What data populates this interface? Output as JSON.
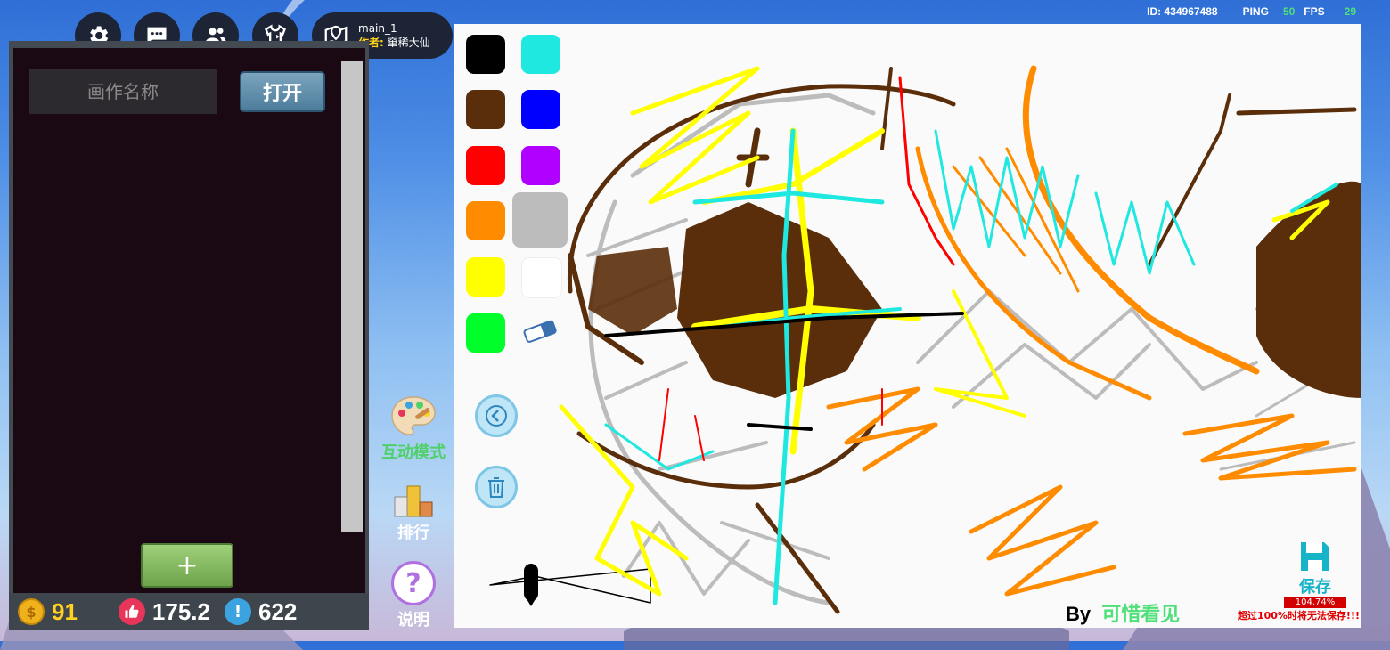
{
  "top_bar": {
    "buttons": [
      {
        "name": "settings",
        "icon": "gear-icon"
      },
      {
        "name": "chat",
        "icon": "chat-icon"
      },
      {
        "name": "friends",
        "icon": "friends-icon"
      },
      {
        "name": "outfit",
        "icon": "shirt-icon"
      }
    ],
    "map": {
      "icon": "map-pin-icon",
      "name": "main_1",
      "author_label": "作者:",
      "author": "窜稀大仙"
    }
  },
  "stats": {
    "id_label": "ID:",
    "id": "434967488",
    "ping_label": "PING",
    "ping": "50",
    "fps_label": "FPS",
    "fps": "29"
  },
  "gallery_panel": {
    "name_placeholder": "画作名称",
    "open_label": "打开",
    "add_label": "+"
  },
  "status_bar": {
    "coins": "91",
    "likes": "175.2",
    "alerts": "622"
  },
  "side_menu": [
    {
      "label": "互动模式",
      "icon": "palette-icon",
      "color": "#4fd06a"
    },
    {
      "label": "排行",
      "icon": "podium-icon",
      "color": "#ffffff"
    },
    {
      "label": "说明",
      "icon": "question-icon",
      "color": "#ffffff"
    }
  ],
  "palette": {
    "colors": [
      "#000000",
      "#1ee8e0",
      "#5a2e0a",
      "#0000ff",
      "#ff0000",
      "#b000ff",
      "#ff8c00",
      "#bcbcbc",
      "#ffff00",
      "#ffffff",
      "#00ff2a"
    ],
    "selected": "#bcbcbc",
    "tools": [
      "eraser-icon",
      "back-icon",
      "trash-icon"
    ]
  },
  "signature": {
    "by": "By",
    "author": "可惜看见",
    "author_color": "#4fe07a"
  },
  "save": {
    "label": "保存",
    "percent": "104.74%",
    "warning": "超过100%时将无法保存!!!"
  }
}
